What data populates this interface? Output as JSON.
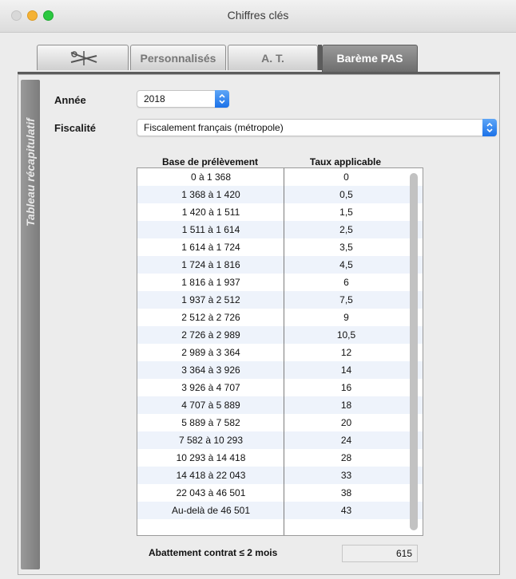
{
  "window": {
    "title": "Chiffres clés"
  },
  "tabs": [
    {
      "label": "",
      "icon": "scissors-wrench-icon"
    },
    {
      "label": "Personnalisés"
    },
    {
      "label": "A. T."
    },
    {
      "label": "Barème PAS",
      "active": true
    }
  ],
  "side_tab": {
    "label": "Tableau récapitulatif"
  },
  "form": {
    "annee_label": "Année",
    "annee_value": "2018",
    "fiscalite_label": "Fiscalité",
    "fiscalite_value": "Fiscalement français (métropole)"
  },
  "table": {
    "headers": [
      "Base de prélèvement",
      "Taux applicable"
    ],
    "rows": [
      [
        "0  à  1 368",
        "0"
      ],
      [
        "1 368  à  1 420",
        "0,5"
      ],
      [
        "1 420  à  1 511",
        "1,5"
      ],
      [
        "1 511  à  1 614",
        "2,5"
      ],
      [
        "1 614  à  1 724",
        "3,5"
      ],
      [
        "1 724  à  1 816",
        "4,5"
      ],
      [
        "1 816  à  1 937",
        "6"
      ],
      [
        "1 937  à  2 512",
        "7,5"
      ],
      [
        "2 512  à  2 726",
        "9"
      ],
      [
        "2 726  à  2 989",
        "10,5"
      ],
      [
        "2 989  à  3 364",
        "12"
      ],
      [
        "3 364  à  3 926",
        "14"
      ],
      [
        "3 926  à  4 707",
        "16"
      ],
      [
        "4 707  à  5 889",
        "18"
      ],
      [
        "5 889  à  7 582",
        "20"
      ],
      [
        "7 582  à  10 293",
        "24"
      ],
      [
        "10 293  à  14 418",
        "28"
      ],
      [
        "14 418  à  22 043",
        "33"
      ],
      [
        "22 043  à  46 501",
        "38"
      ],
      [
        "Au-delà de  46 501",
        "43"
      ]
    ]
  },
  "footer": {
    "label": "Abattement contrat ≤ 2 mois",
    "value": "615"
  },
  "colors": {
    "accent": "#1b71e8",
    "row_alt": "#eef3fb"
  }
}
